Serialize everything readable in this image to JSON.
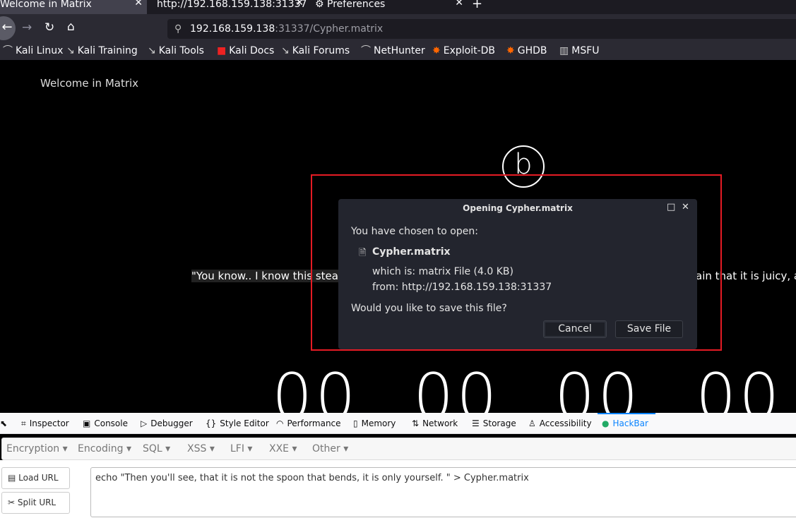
{
  "browser": {
    "tabs": [
      {
        "label": "Welcome in Matrix",
        "active": true
      },
      {
        "label": "http://192.168.159.138:31337"
      },
      {
        "label": "Preferences",
        "icon": "gear-icon"
      }
    ],
    "close_glyph": "✕",
    "new_tab_glyph": "+",
    "url_host": "192.168.159.138",
    "url_rest": ":31337/Cypher.matrix",
    "bookmarks": [
      "Kali Linux",
      "Kali Training",
      "Kali Tools",
      "Kali Docs",
      "Kali Forums",
      "NetHunter",
      "Exploit-DB",
      "GHDB",
      "MSFU"
    ]
  },
  "page": {
    "welcome": "Welcome in Matrix",
    "logo_letter": "b",
    "quote_left": "\"You know.. I know this steak",
    "quote_right": "ain that it is juicy, an",
    "digits": [
      "00",
      "00",
      "00",
      "00"
    ]
  },
  "dialog": {
    "title": "Opening Cypher.matrix",
    "intro": "You have chosen to open:",
    "filename": "Cypher.matrix",
    "which_is_label": "which is:",
    "which_is_value": "matrix File (4.0 KB)",
    "from_label": "from:",
    "from_value": "http://192.168.159.138:31337",
    "question": "Would you like to save this file?",
    "cancel": "Cancel",
    "save": "Save File"
  },
  "devtools": {
    "tabs": [
      "Inspector",
      "Console",
      "Debugger",
      "Style Editor",
      "Performance",
      "Memory",
      "Network",
      "Storage",
      "Accessibility",
      "HackBar"
    ],
    "active": "HackBar",
    "accent": "#0a84ff"
  },
  "hackbar": {
    "menus": [
      "Encryption",
      "Encoding",
      "SQL",
      "XSS",
      "LFI",
      "XXE",
      "Other"
    ],
    "load_url": "Load URL",
    "split_url": "Split URL",
    "command": "echo \"Then you'll see, that it is not the spoon that bends, it is only yourself. \" > Cypher.matrix"
  },
  "colors": {
    "highlight_box": "#e51b24",
    "dialog_bg": "#23252e"
  }
}
